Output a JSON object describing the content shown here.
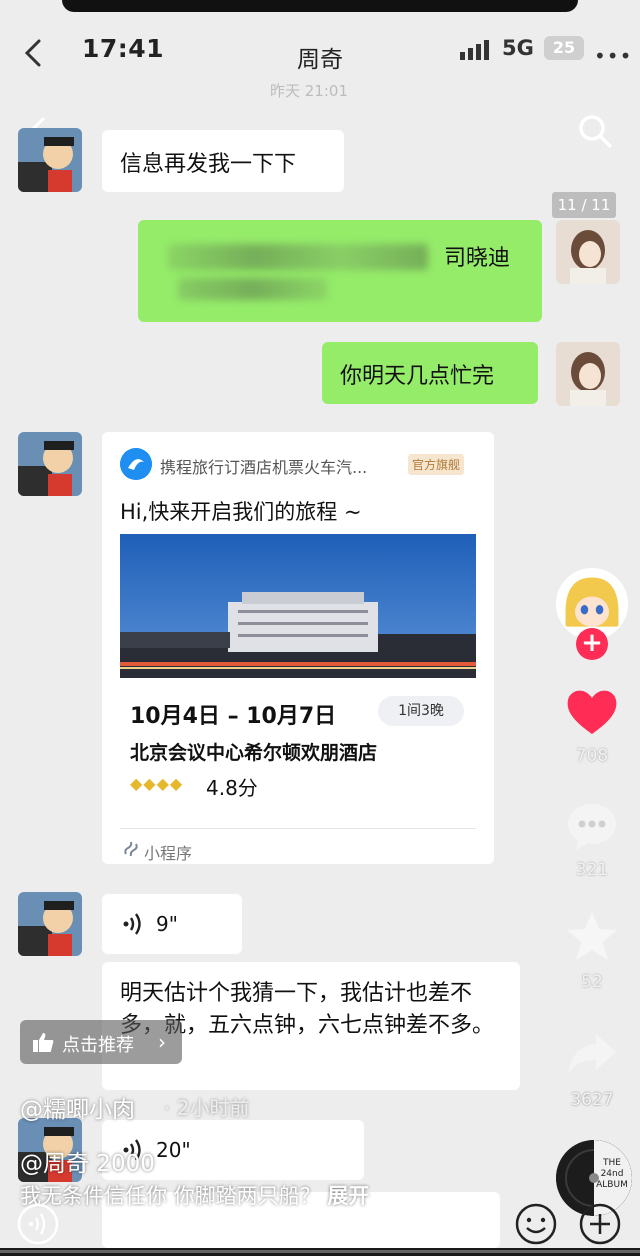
{
  "status": {
    "time": "17:41",
    "network": "5G",
    "battery": "25",
    "chat_title": "周奇",
    "more_dots": "•••"
  },
  "faint_timestamp": "昨天 21:01",
  "overlay": {
    "page_indicator": "11 / 11",
    "recommend_label": "点击推荐",
    "recommend_chevron": "›",
    "author": "@糯唧小肉",
    "age": "· 2小时前",
    "mention": "@周奇 2000",
    "caption": "我无条件信任你 你脚踏两只船？",
    "expand": "展开",
    "album_text": "THE 24nd ALBUM"
  },
  "messages": {
    "m1": "信息再发我一下下",
    "m2_name": "司晓迪",
    "m3": "你明天几点忙完",
    "card": {
      "source": "携程旅行订酒店机票火车汽...",
      "badge": "官方旗舰",
      "heading": "Hi,快来开启我们的旅程 ~",
      "dates": "10月4日 – 10月7日",
      "rooms": "1间3晚",
      "hotel": "北京会议中心希尔顿欢朋酒店",
      "diamonds": "◆◆◆◆",
      "rating": "4.8分",
      "mini_program_label": "小程序"
    },
    "voice1": "9\"",
    "long_text": "明天估计个我猜一下，我估计也差不多，就，五六点钟，六七点钟差不多。",
    "voice2": "20\""
  },
  "rail": {
    "likes": "708",
    "comments": "321",
    "favorites": "52",
    "shares": "3627",
    "follow": "+"
  },
  "colors": {
    "chat_bg": "#ededed",
    "bubble_me": "#95ec69",
    "bubble_other": "#ffffff",
    "like": "#ff2c55",
    "follow": "#ff2c55"
  }
}
